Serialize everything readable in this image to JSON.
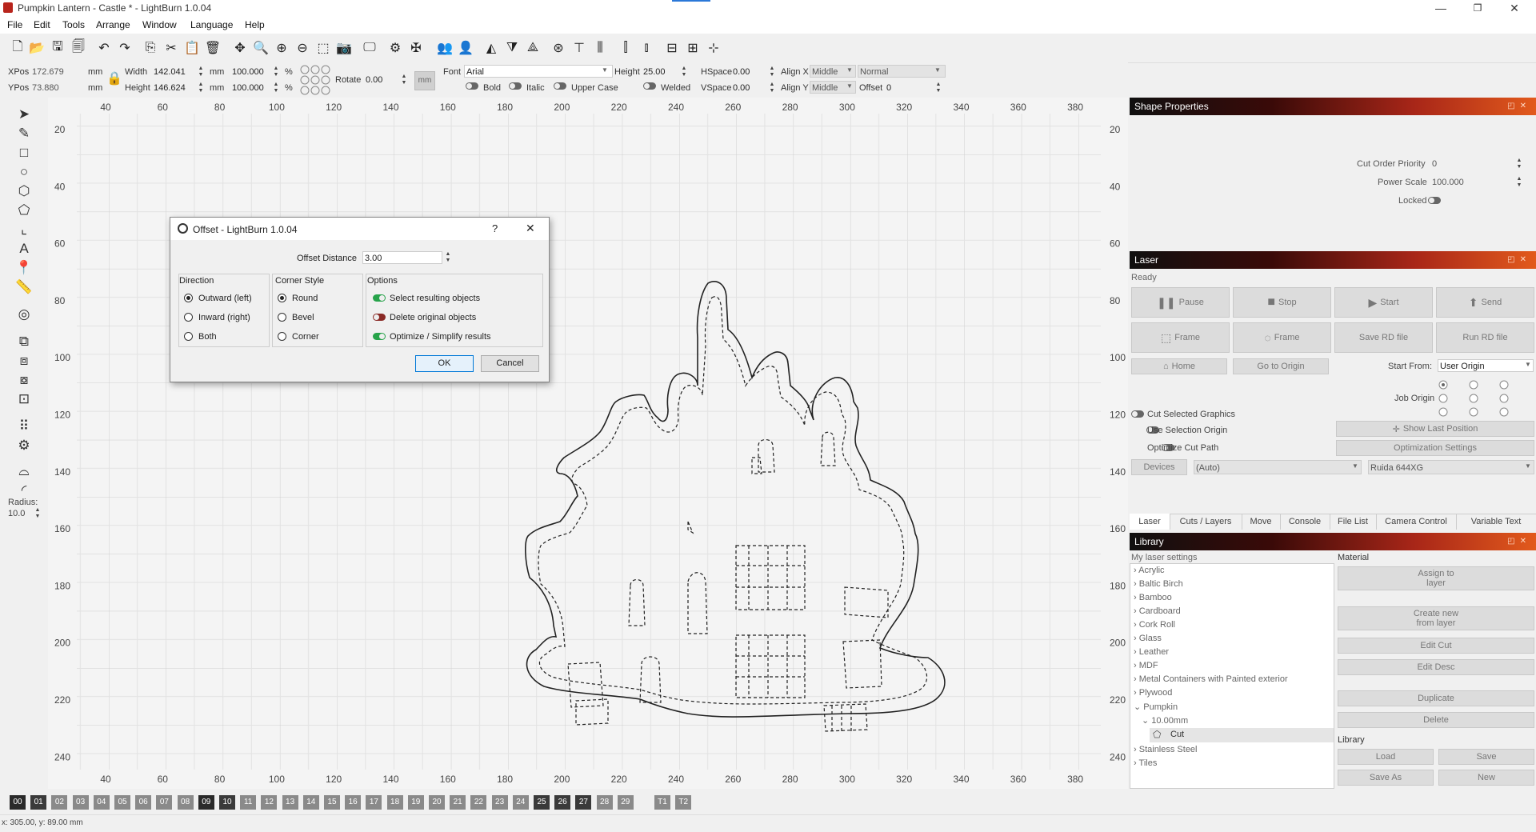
{
  "window": {
    "title": "Pumpkin Lantern - Castle * - LightBurn 1.0.04",
    "controls": [
      "—",
      "❐",
      "✕"
    ]
  },
  "menu": [
    "File",
    "Edit",
    "Tools",
    "Arrange",
    "Window",
    "Language",
    "Help"
  ],
  "props": {
    "xpos_label": "XPos",
    "xpos": "172.679",
    "ypos_label": "YPos",
    "ypos": "73.880",
    "unit_mm": "mm",
    "width_label": "Width",
    "width": "142.041",
    "height_label": "Height",
    "height": "146.624",
    "scale_w": "100.000",
    "scale_h": "100.000",
    "pct": "%",
    "rotate_label": "Rotate",
    "rotate": "0.00",
    "mm_toggle": "mm",
    "font_label": "Font",
    "font": "Arial",
    "fheight_label": "Height",
    "fheight": "25.00",
    "hspace_label": "HSpace",
    "hspace": "0.00",
    "vspace_label": "VSpace",
    "vspace": "0.00",
    "alignx_label": "Align X",
    "alignx": "Middle",
    "aligny_label": "Align Y",
    "aligny": "Middle",
    "style": "Normal",
    "offset_label": "Offset",
    "offset": "0",
    "bold": "Bold",
    "italic": "Italic",
    "uppercase": "Upper Case",
    "welded": "Welded"
  },
  "ruler": {
    "x_ticks": [
      "40",
      "60",
      "80",
      "100",
      "120",
      "140",
      "160",
      "180",
      "200",
      "220",
      "240",
      "260",
      "280",
      "300",
      "320",
      "340",
      "360",
      "380"
    ],
    "y_ticks": [
      "20",
      "40",
      "60",
      "80",
      "100",
      "120",
      "140",
      "160",
      "180",
      "200",
      "220",
      "240"
    ]
  },
  "radius": {
    "label": "Radius:",
    "value": "10.0"
  },
  "dialog": {
    "title": "Offset - LightBurn 1.0.04",
    "help": "?",
    "close": "✕",
    "distance_label": "Offset Distance",
    "distance_value": "3.00",
    "direction_title": "Direction",
    "direction_options": [
      "Outward (left)",
      "Inward (right)",
      "Both"
    ],
    "corner_title": "Corner Style",
    "corner_options": [
      "Round",
      "Bevel",
      "Corner"
    ],
    "options_title": "Options",
    "options": [
      "Select resulting objects",
      "Delete original objects",
      "Optimize / Simplify results"
    ],
    "ok": "OK",
    "cancel": "Cancel"
  },
  "shape_props": {
    "title": "Shape Properties",
    "cut_order_label": "Cut Order Priority",
    "cut_order": "0",
    "power_scale_label": "Power Scale",
    "power_scale": "100.000",
    "locked_label": "Locked"
  },
  "laser": {
    "title": "Laser",
    "status": "Ready",
    "buttons_row1": [
      "Pause",
      "Stop",
      "Start",
      "Send"
    ],
    "buttons_row2": [
      "Frame",
      "Frame",
      "Save RD file",
      "Run RD file"
    ],
    "home": "Home",
    "go_origin": "Go to Origin",
    "start_from_label": "Start From:",
    "start_from": "User Origin",
    "job_origin_label": "Job Origin",
    "cut_selected": "Cut Selected Graphics",
    "use_selection_origin": "Use Selection Origin",
    "optimize_cut": "Optimize Cut Path",
    "show_last": "Show Last Position",
    "opt_settings": "Optimization Settings",
    "devices": "Devices",
    "device_port": "(Auto)",
    "device_model": "Ruida 644XG"
  },
  "tabs": [
    "Laser",
    "Cuts / Layers",
    "Move",
    "Console",
    "File List",
    "Camera Control",
    "Variable Text"
  ],
  "library": {
    "title": "Library",
    "my_settings": "My laser settings",
    "material_label": "Material",
    "items": [
      "Acrylic",
      "Baltic Birch",
      "Bamboo",
      "Cardboard",
      "Cork Roll",
      "Glass",
      "Leather",
      "MDF",
      "Metal Containers with Painted exterior",
      "Plywood",
      "Pumpkin"
    ],
    "pumpkin_child": "10.00mm",
    "pumpkin_leaf": "Cut",
    "items_after": [
      "Stainless Steel",
      "Tiles"
    ],
    "assign": "Assign to\nlayer",
    "create_new": "Create new\nfrom layer",
    "edit_cut": "Edit Cut",
    "edit_desc": "Edit Desc",
    "duplicate": "Duplicate",
    "delete": "Delete",
    "library_label": "Library",
    "load": "Load",
    "save": "Save",
    "save_as": "Save As",
    "new": "New"
  },
  "layers": [
    "00",
    "01",
    "02",
    "03",
    "04",
    "05",
    "06",
    "07",
    "08",
    "09",
    "10",
    "11",
    "12",
    "13",
    "14",
    "15",
    "16",
    "17",
    "18",
    "19",
    "20",
    "21",
    "22",
    "23",
    "24",
    "25",
    "26",
    "27",
    "28",
    "29",
    "T1",
    "T2"
  ],
  "layer_colors": [
    "#2a2a2a",
    "#3a3a3a",
    "#8a8a8a",
    "#8a8a8a",
    "#8a8a8a",
    "#8a8a8a",
    "#8a8a8a",
    "#8a8a8a",
    "#8a8a8a",
    "#2a2a2a",
    "#3a3a3a",
    "#8a8a8a",
    "#8a8a8a",
    "#8a8a8a",
    "#8a8a8a",
    "#8a8a8a",
    "#8a8a8a",
    "#8a8a8a",
    "#8a8a8a",
    "#8a8a8a",
    "#8a8a8a",
    "#8a8a8a",
    "#8a8a8a",
    "#8a8a8a",
    "#8a8a8a",
    "#3a3a3a",
    "#3a3a3a",
    "#3a3a3a",
    "#8a8a8a",
    "#8a8a8a",
    "#8a8a8a",
    "#8a8a8a"
  ],
  "status": "x: 305.00, y: 89.00 mm"
}
